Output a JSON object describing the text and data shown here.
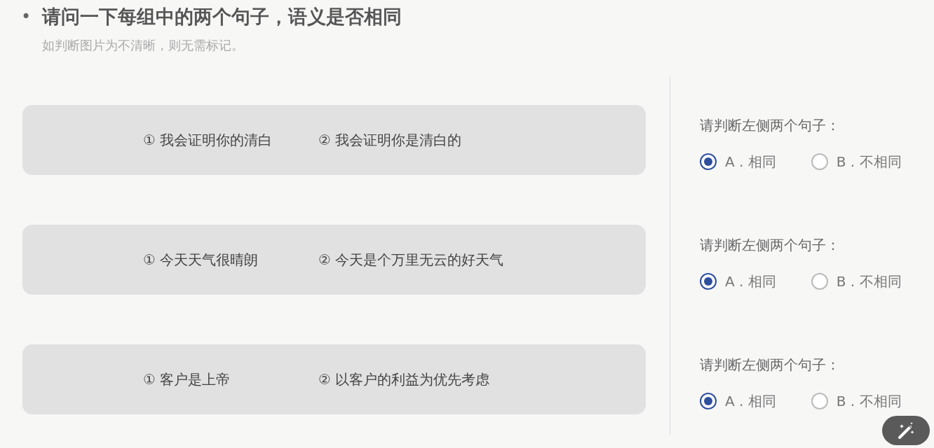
{
  "question": {
    "bullet": "•",
    "title": "请问一下每组中的两个句子，语义是否相同",
    "hint": "如判断图片为不清晰，则无需标记。"
  },
  "groups": [
    {
      "sentences": [
        "① 我会证明你的清白",
        "② 我会证明你是清白的"
      ],
      "prompt": "请判断左侧两个句子：",
      "options": [
        {
          "label": "A . 相同",
          "selected": true
        },
        {
          "label": "B . 不相同",
          "selected": false
        }
      ]
    },
    {
      "sentences": [
        "① 今天天气很晴朗",
        "② 今天是个万里无云的好天气"
      ],
      "prompt": "请判断左侧两个句子：",
      "options": [
        {
          "label": "A . 相同",
          "selected": true
        },
        {
          "label": "B . 不相同",
          "selected": false
        }
      ]
    },
    {
      "sentences": [
        "① 客户是上帝",
        "② 以客户的利益为优先考虑"
      ],
      "prompt": "请判断左侧两个句子：",
      "options": [
        {
          "label": "A . 相同",
          "selected": true
        },
        {
          "label": "B . 不相同",
          "selected": false
        }
      ]
    }
  ]
}
